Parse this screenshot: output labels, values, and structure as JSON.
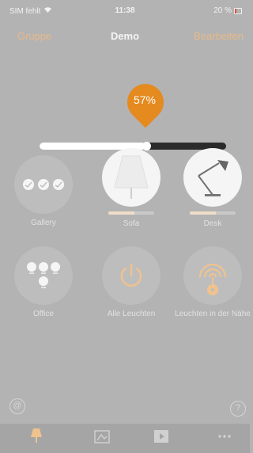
{
  "status": {
    "carrier": "SIM fehlt",
    "time": "11:38",
    "battery": "20 %"
  },
  "nav": {
    "left": "Gruppe",
    "title": "Demo",
    "right": "Bearbeiten"
  },
  "brightness": {
    "label": "57%",
    "value": 0.57
  },
  "tiles": [
    {
      "label": "Gallery",
      "icon": "three-bulbs-icon"
    },
    {
      "label": "Sofa",
      "icon": "sofa-lamp-icon",
      "level": 0.57
    },
    {
      "label": "Desk",
      "icon": "desk-lamp-icon",
      "level": 0.57
    },
    {
      "label": "Office",
      "icon": "four-bulbs-icon"
    },
    {
      "label": "Alle Leuchten",
      "icon": "power-icon"
    },
    {
      "label": "Leuchten in der Nähe",
      "icon": "nearby-signal-icon"
    }
  ],
  "colors": {
    "accent": "#e58a1f",
    "background": "#b3b3b3"
  }
}
